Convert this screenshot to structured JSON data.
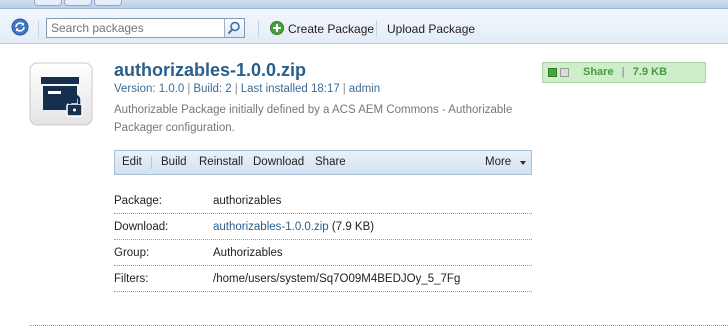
{
  "toolbar": {
    "search_placeholder": "Search packages",
    "create_package": "Create Package",
    "upload_package": "Upload Package"
  },
  "package": {
    "title": "authorizables-1.0.0.zip",
    "version": "Version: 1.0.0",
    "build": "Build: 2",
    "last_installed": "Last installed 18:17",
    "installed_by": "admin",
    "meta_separator": "|",
    "description": "Authorizable Package initially defined by a ACS AEM Commons - Authorizable Packager configuration.",
    "share": {
      "label": "Share",
      "separator": "|",
      "size": "7.9 KB"
    }
  },
  "actions": {
    "edit": "Edit",
    "build": "Build",
    "reinstall": "Reinstall",
    "download": "Download",
    "share": "Share",
    "more": "More"
  },
  "properties": [
    {
      "label": "Package:",
      "value": "authorizables"
    },
    {
      "label": "Download:",
      "link": "authorizables-1.0.0.zip",
      "suffix": " (7.9 KB)"
    },
    {
      "label": "Group:",
      "value": "Authorizables"
    },
    {
      "label": "Filters:",
      "value": "/home/users/system/Sq7O09M4BEDJOy_5_7Fg"
    }
  ],
  "colors": {
    "title": "#2b5e88",
    "link": "#2b5e88",
    "share_green": "#4a9a3f",
    "share_bg": "#cdeec8"
  }
}
